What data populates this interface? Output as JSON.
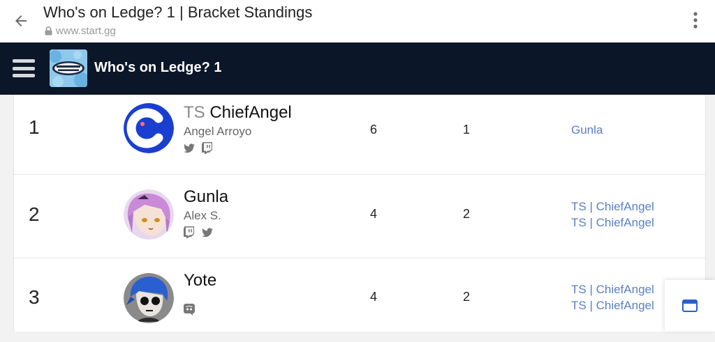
{
  "browser": {
    "title": "Who's on Ledge? 1 | Bracket Standings",
    "url": "www.start.gg"
  },
  "header": {
    "event_name": "Who's on Ledge? 1"
  },
  "standings": [
    {
      "placement": "1",
      "prefix": "TS",
      "gamertag": "ChiefAngel",
      "real_name": "Angel Arroyo",
      "socials": [
        "twitter-icon",
        "twitch-icon"
      ],
      "stat_a": "6",
      "stat_b": "1",
      "eliminated_by": [
        "Gunla"
      ]
    },
    {
      "placement": "2",
      "prefix": "",
      "gamertag": "Gunla",
      "real_name": "Alex S.",
      "socials": [
        "twitch-icon",
        "twitter-icon"
      ],
      "stat_a": "4",
      "stat_b": "2",
      "eliminated_by": [
        "TS | ChiefAngel",
        "TS | ChiefAngel"
      ]
    },
    {
      "placement": "3",
      "prefix": "",
      "gamertag": "Yote",
      "real_name": "",
      "socials": [
        "discord-icon"
      ],
      "stat_a": "4",
      "stat_b": "2",
      "eliminated_by": [
        "TS | ChiefAngel",
        "TS | ChiefAngel"
      ]
    }
  ],
  "colors": {
    "header_bg": "#0c1629",
    "link": "#5a7fc4",
    "avatar_blue": "#1a3fd0"
  }
}
